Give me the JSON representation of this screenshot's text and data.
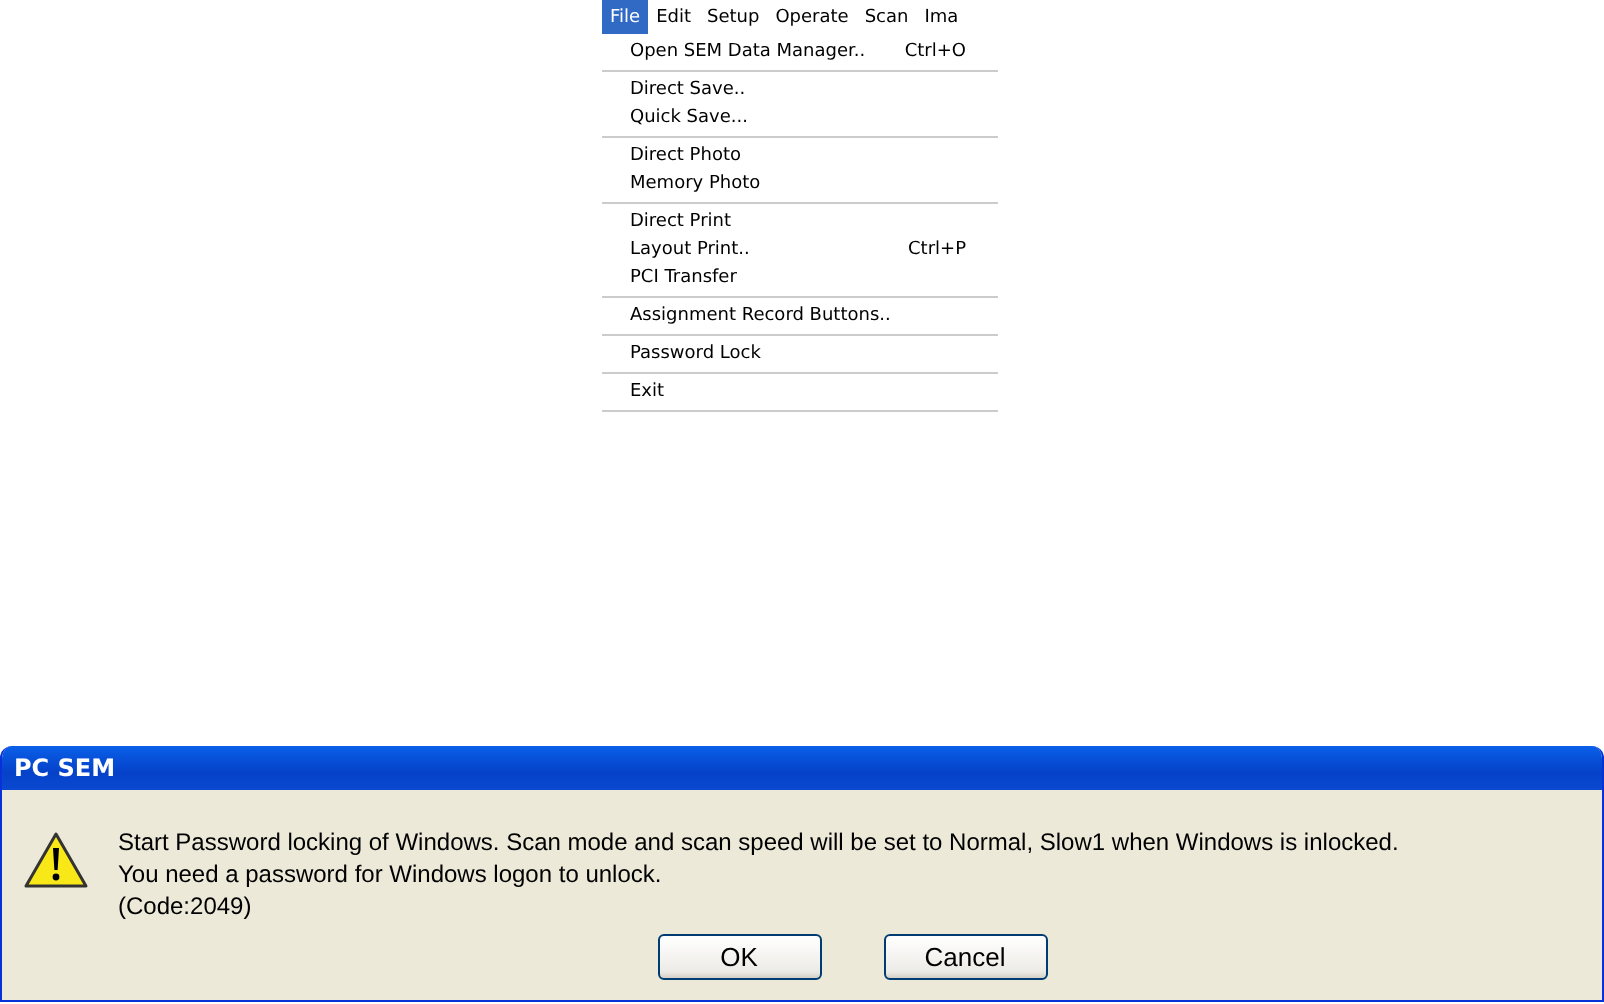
{
  "menu_bar": [
    {
      "label": "File",
      "selected": true
    },
    {
      "label": "Edit",
      "selected": false
    },
    {
      "label": "Setup",
      "selected": false
    },
    {
      "label": "Operate",
      "selected": false
    },
    {
      "label": "Scan",
      "selected": false
    },
    {
      "label": "Ima",
      "selected": false
    }
  ],
  "file_menu": {
    "groups": [
      [
        {
          "label": "Open SEM Data Manager..",
          "shortcut": "Ctrl+O"
        }
      ],
      [
        {
          "label": "Direct Save.."
        },
        {
          "label": "Quick Save..."
        }
      ],
      [
        {
          "label": "Direct Photo"
        },
        {
          "label": "Memory Photo"
        }
      ],
      [
        {
          "label": "Direct Print"
        },
        {
          "label": "Layout Print..",
          "shortcut": "Ctrl+P"
        },
        {
          "label": "PCI Transfer"
        }
      ],
      [
        {
          "label": "Assignment Record Buttons.."
        }
      ],
      [
        {
          "label": "Password Lock"
        }
      ],
      [
        {
          "label": "Exit"
        }
      ]
    ]
  },
  "dialog": {
    "title": "PC SEM",
    "message_lines": [
      "Start Password locking of Windows. Scan mode and scan speed will be set to Normal, Slow1 when Windows is inlocked.",
      "You need a password for Windows logon to unlock.",
      "(Code:2049)"
    ],
    "buttons": [
      "OK",
      "Cancel"
    ]
  }
}
